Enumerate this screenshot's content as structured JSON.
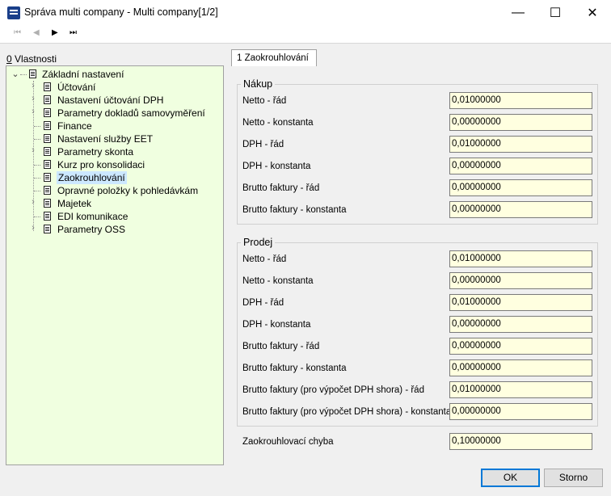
{
  "window": {
    "title": "Správa multi company - Multi company[1/2]",
    "minimize": "—",
    "maximize": "☐",
    "close": "✕"
  },
  "toolbar": {
    "first": "⏮",
    "prev": "◀",
    "next": "▶",
    "last": "⏭"
  },
  "properties_label_key": "0",
  "properties_label_rest": " Vlastnosti",
  "tree": {
    "root": "Základní nastavení",
    "items": [
      "Účtování",
      "Nastavení účtování DPH",
      "Parametry dokladů samovyměření",
      "Finance",
      "Nastavení služby EET",
      "Parametry skonta",
      "Kurz pro konsolidaci",
      "Zaokrouhlování",
      "Opravné položky k pohledávkám",
      "Majetek",
      "EDI komunikace",
      "Parametry OSS"
    ]
  },
  "tab": "1 Zaokrouhlování",
  "purchase": {
    "title": "Nákup",
    "fields": [
      {
        "label": "Netto - řád",
        "value": "0,01000000"
      },
      {
        "label": "Netto - konstanta",
        "value": "0,00000000"
      },
      {
        "label": "DPH - řád",
        "value": "0,01000000"
      },
      {
        "label": "DPH - konstanta",
        "value": "0,00000000"
      },
      {
        "label": "Brutto faktury - řád",
        "value": "0,00000000"
      },
      {
        "label": "Brutto faktury - konstanta",
        "value": "0,00000000"
      }
    ]
  },
  "sales": {
    "title": "Prodej",
    "fields": [
      {
        "label": "Netto - řád",
        "value": "0,01000000"
      },
      {
        "label": "Netto - konstanta",
        "value": "0,00000000"
      },
      {
        "label": "DPH - řád",
        "value": "0,01000000"
      },
      {
        "label": "DPH - konstanta",
        "value": "0,00000000"
      },
      {
        "label": "Brutto faktury - řád",
        "value": "0,00000000"
      },
      {
        "label": "Brutto faktury - konstanta",
        "value": "0,00000000"
      },
      {
        "label": "Brutto faktury (pro výpočet DPH shora) - řád",
        "value": "0,01000000"
      },
      {
        "label": "Brutto faktury (pro výpočet DPH shora) - konstanta",
        "value": "0,00000000"
      }
    ]
  },
  "rounding_error": {
    "label": "Zaokrouhlovací chyba",
    "value": "0,10000000"
  },
  "buttons": {
    "ok": "OK",
    "cancel": "Storno"
  }
}
